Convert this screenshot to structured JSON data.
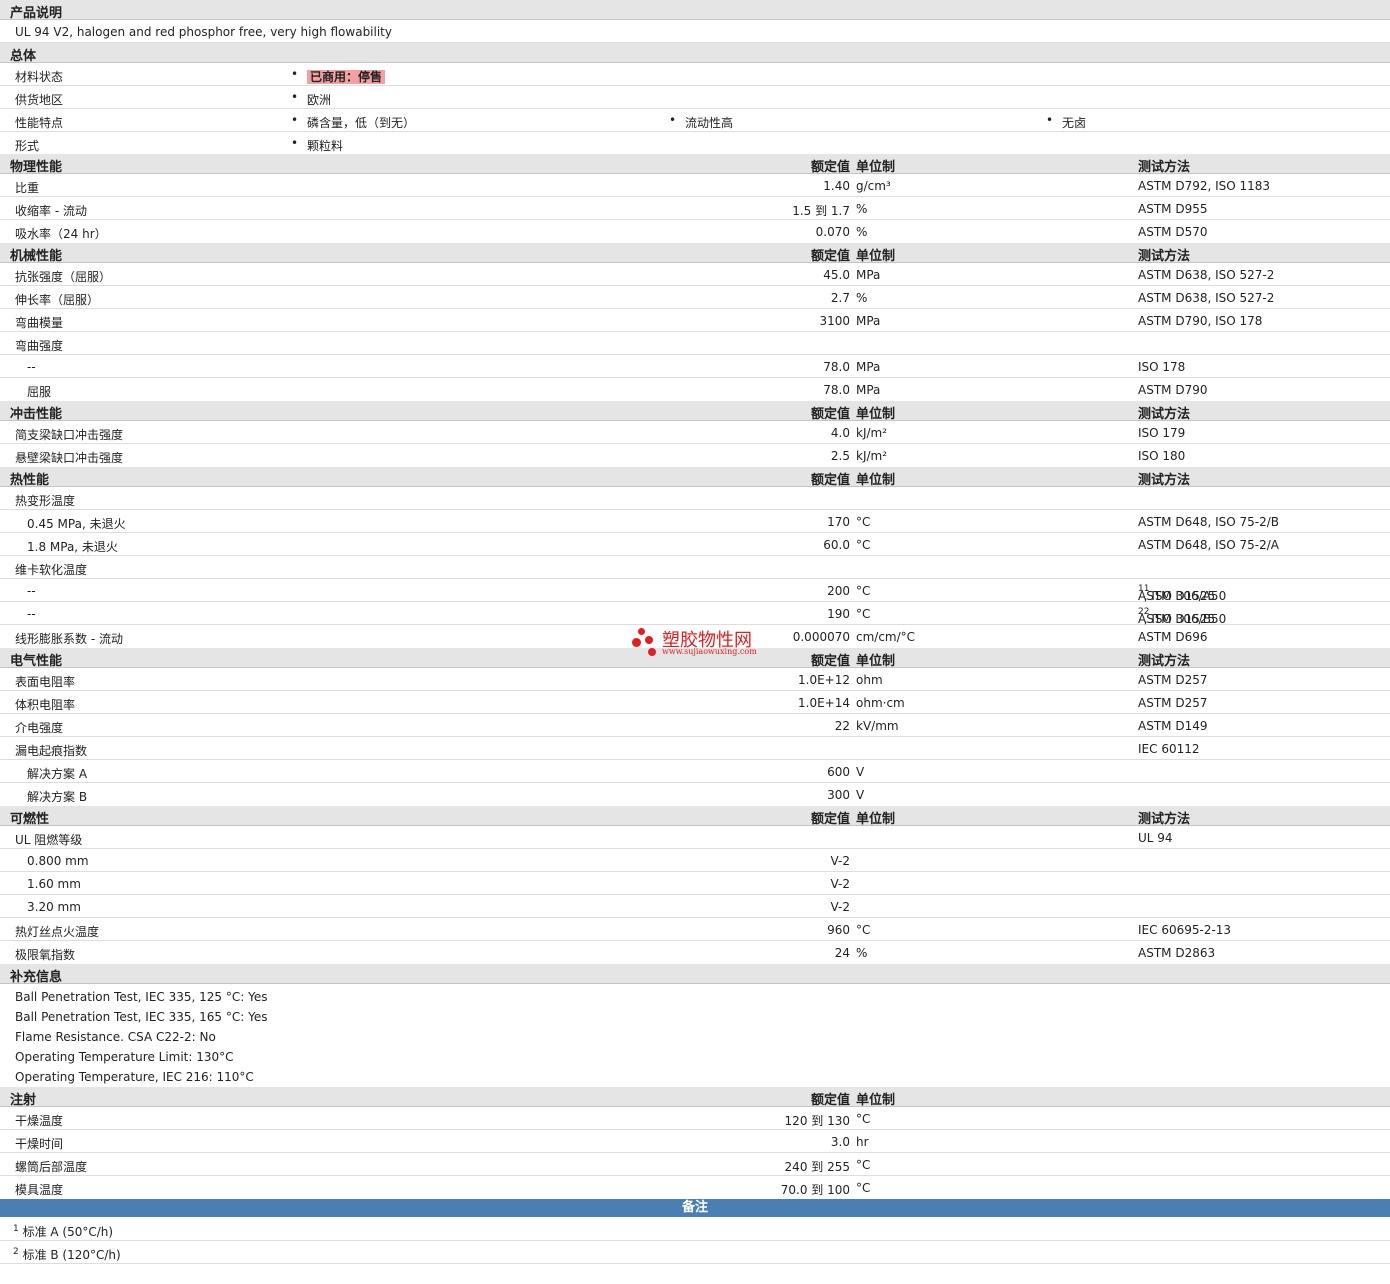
{
  "description": {
    "title": "产品说明",
    "text": "UL 94 V2, halogen and red phosphor free, very high flowability"
  },
  "general": {
    "title": "总体",
    "status_label": "材料状态",
    "status_value": "已商用：停售",
    "region_label": "供货地区",
    "region_value": "欧洲",
    "features_label": "性能特点",
    "features": [
      "磷含量，低（到无）",
      "流动性高",
      "无卤"
    ],
    "form_label": "形式",
    "form_value": "颗粒料"
  },
  "headers": {
    "value": "额定值",
    "unit": "单位制",
    "method": "测试方法"
  },
  "physical": {
    "title": "物理性能",
    "rows": [
      {
        "label": "比重",
        "value": "1.40",
        "unit": "g/cm³",
        "method": "ASTM D792, ISO 1183"
      },
      {
        "label": "收缩率 - 流动",
        "value": "1.5 到  1.7",
        "unit": "%",
        "method": "ASTM D955"
      },
      {
        "label": "吸水率（24 hr）",
        "value": "0.070",
        "unit": "%",
        "method": "ASTM D570"
      }
    ]
  },
  "mechanical": {
    "title": "机械性能",
    "rows": [
      {
        "label": "抗张强度（屈服）",
        "value": "45.0",
        "unit": "MPa",
        "method": "ASTM D638, ISO 527-2"
      },
      {
        "label": "伸长率（屈服）",
        "value": "2.7",
        "unit": "%",
        "method": "ASTM D638, ISO 527-2"
      },
      {
        "label": "弯曲模量",
        "value": "3100",
        "unit": "MPa",
        "method": "ASTM D790, ISO 178"
      },
      {
        "label": "弯曲强度",
        "value": "",
        "unit": "",
        "method": ""
      },
      {
        "label": "--",
        "value": "78.0",
        "unit": "MPa",
        "method": "ISO 178"
      },
      {
        "label": "屈服",
        "value": "78.0",
        "unit": "MPa",
        "method": "ASTM D790"
      }
    ]
  },
  "impact": {
    "title": "冲击性能",
    "rows": [
      {
        "label": "简支梁缺口冲击强度",
        "value": "4.0",
        "unit": "kJ/m²",
        "method": "ISO 179"
      },
      {
        "label": "悬壁梁缺口冲击强度",
        "value": "2.5",
        "unit": "kJ/m²",
        "method": "ISO 180"
      }
    ]
  },
  "thermal": {
    "title": "热性能",
    "rows": [
      {
        "label": "热变形温度",
        "value": "",
        "unit": "",
        "method": ""
      },
      {
        "label": "0.45 MPa, 未退火",
        "value": "170",
        "unit": "°C",
        "method": "ASTM D648, ISO 75-2/B"
      },
      {
        "label": "1.8 MPa, 未退火",
        "value": "60.0",
        "unit": "°C",
        "method": "ASTM D648, ISO 75-2/A"
      },
      {
        "label": "维卡软化温度",
        "value": "",
        "unit": "",
        "method": ""
      },
      {
        "label": "--",
        "value": "200",
        "unit": "°C",
        "method_a": "ASTM D1525 ",
        "sup_a": "1",
        "method_b": ", ISO 306/A50 ",
        "sup_b": "1"
      },
      {
        "label": "--",
        "value": "190",
        "unit": "°C",
        "method_a": "ASTM D1525 ",
        "sup_a": "2",
        "method_b": ", ISO 306/B50 ",
        "sup_b": "2"
      },
      {
        "label": "线形膨胀系数 - 流动",
        "value": "0.000070",
        "unit": "cm/cm/°C",
        "method": "ASTM D696"
      }
    ]
  },
  "electrical": {
    "title": "电气性能",
    "rows": [
      {
        "label": "表面电阻率",
        "value": "1.0E+12",
        "unit": "ohm",
        "method": "ASTM D257"
      },
      {
        "label": "体积电阻率",
        "value": "1.0E+14",
        "unit": "ohm·cm",
        "method": "ASTM D257"
      },
      {
        "label": "介电强度",
        "value": "22",
        "unit": "kV/mm",
        "method": "ASTM D149"
      },
      {
        "label": "漏电起痕指数",
        "value": "",
        "unit": "",
        "method": "IEC 60112"
      },
      {
        "label": "解决方案 A",
        "value": "600",
        "unit": "V",
        "method": ""
      },
      {
        "label": "解决方案 B",
        "value": "300",
        "unit": "V",
        "method": ""
      }
    ]
  },
  "flammability": {
    "title": "可燃性",
    "rows": [
      {
        "label": "UL 阻燃等级",
        "value": "",
        "unit": "",
        "method": "UL 94"
      },
      {
        "label": "0.800 mm",
        "value": "V-2",
        "unit": "",
        "method": ""
      },
      {
        "label": "1.60 mm",
        "value": "V-2",
        "unit": "",
        "method": ""
      },
      {
        "label": "3.20 mm",
        "value": "V-2",
        "unit": "",
        "method": ""
      },
      {
        "label": "热灯丝点火温度",
        "value": "960",
        "unit": "°C",
        "method": "IEC 60695-2-13"
      },
      {
        "label": "极限氧指数",
        "value": "24",
        "unit": "%",
        "method": "ASTM D2863"
      }
    ]
  },
  "supplement": {
    "title": "补充信息",
    "lines": [
      "Ball Penetration Test, IEC 335, 125 °C: Yes",
      "Ball Penetration Test, IEC 335, 165 °C: Yes",
      "Flame Resistance. CSA C22-2: No",
      "Operating Temperature Limit: 130°C",
      "Operating Temperature, IEC 216: 110°C"
    ]
  },
  "injection": {
    "title": "注射",
    "rows": [
      {
        "label": "干燥温度",
        "value": "120 到  130",
        "unit": "°C"
      },
      {
        "label": "干燥时间",
        "value": "3.0",
        "unit": "hr"
      },
      {
        "label": "螺筒后部温度",
        "value": "240 到  255",
        "unit": "°C"
      },
      {
        "label": "模具温度",
        "value": "70.0 到  100",
        "unit": "°C"
      }
    ]
  },
  "notes": {
    "title": "备注",
    "items": [
      {
        "sup": "1",
        "text": "标准 A (50°C/h)"
      },
      {
        "sup": "2",
        "text": "标准 B (120°C/h)"
      }
    ]
  },
  "watermark": {
    "name": "塑胶物性网",
    "url": "www.sujiaowuxing.com"
  }
}
